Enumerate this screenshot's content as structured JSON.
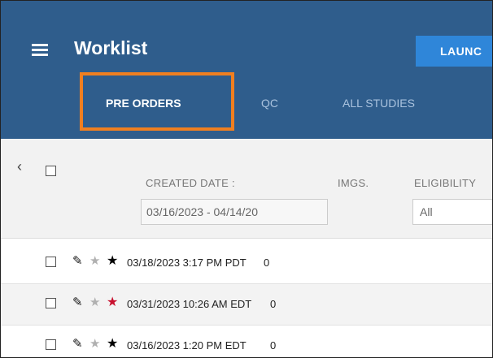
{
  "header": {
    "title": "Worklist",
    "launch_label": "LAUNC",
    "tabs": [
      {
        "label": "PRE ORDERS",
        "active": true
      },
      {
        "label": "QC",
        "active": false
      },
      {
        "label": "ALL STUDIES",
        "active": false
      }
    ],
    "highlight_color": "#f07f20",
    "background_color": "#2f5d8c"
  },
  "filters": {
    "collapse_icon": "chevron-left-icon",
    "columns": {
      "created_date": "CREATED DATE :",
      "imgs": "IMGS.",
      "eligibility": "ELIGIBILITY"
    },
    "date_range_value": "03/16/2023 - 04/14/20",
    "eligibility_value": "All"
  },
  "rows": [
    {
      "date": "03/18/2023 3:17 PM PDT",
      "imgs": "0",
      "star_color": "#000000"
    },
    {
      "date": "03/31/2023 10:26 AM EDT",
      "imgs": "0",
      "star_color": "#c8102e"
    },
    {
      "date": "03/16/2023 1:20 PM EDT",
      "imgs": "0",
      "star_color": "#000000"
    }
  ]
}
